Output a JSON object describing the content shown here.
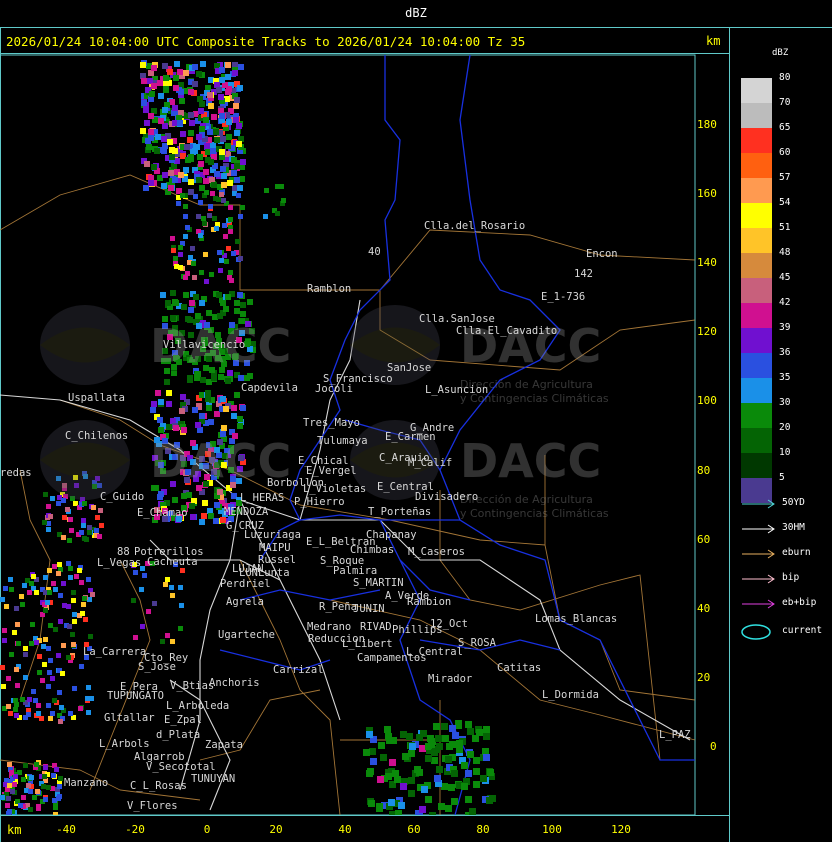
{
  "window": {
    "title": "dBZ"
  },
  "header": {
    "text": "2026/01/24 10:04:00 UTC Composite Tracks to 2026/01/24 10:04:00 Tz 35"
  },
  "axis": {
    "unit": "km",
    "x_ticks": [
      "-40",
      "-20",
      "0",
      "20",
      "40",
      "60",
      "80",
      "100",
      "120"
    ],
    "y_ticks": [
      "180",
      "160",
      "140",
      "120",
      "100",
      "80",
      "60",
      "40",
      "20",
      "0"
    ]
  },
  "legend": {
    "title": "dBZ",
    "levels": [
      {
        "label": "80",
        "color": "#d4d4d4"
      },
      {
        "label": "70",
        "color": "#bcbcbc"
      },
      {
        "label": "65",
        "color": "#ff3020"
      },
      {
        "label": "60",
        "color": "#ff6010"
      },
      {
        "label": "57",
        "color": "#ff9a50"
      },
      {
        "label": "54",
        "color": "#ffff00"
      },
      {
        "label": "51",
        "color": "#ffc428"
      },
      {
        "label": "48",
        "color": "#d68a3c"
      },
      {
        "label": "45",
        "color": "#c8607c"
      },
      {
        "label": "42",
        "color": "#d01090"
      },
      {
        "label": "39",
        "color": "#7010d0"
      },
      {
        "label": "36",
        "color": "#2a50e0"
      },
      {
        "label": "35",
        "color": "#1a90e8"
      },
      {
        "label": "30",
        "color": "#0a8a0a"
      },
      {
        "label": "20",
        "color": "#046404"
      },
      {
        "label": "10",
        "color": "#003800"
      },
      {
        "label": "5",
        "color": "#4a3a90"
      }
    ],
    "tracks": [
      {
        "label": "50YD",
        "color": "#50d8d8"
      },
      {
        "label": "30HM",
        "color": "#ffffff"
      },
      {
        "label": "eburn",
        "color": "#e8b060"
      },
      {
        "label": "bip",
        "color": "#ffc0d0"
      },
      {
        "label": "eb+bip",
        "color": "#e040e0"
      }
    ],
    "current": {
      "label": "current",
      "color": "#30e0e0"
    }
  },
  "watermark": {
    "brand": "DACC",
    "line1": "Dirección de Agricultura",
    "line2": "y Contingencias Climáticas"
  },
  "places": [
    "Clla.del_Rosario",
    "Encon",
    "142",
    "E_1-736",
    "Ramblon",
    "40",
    "Clla.SanJose",
    "Clla.El_Cavadito",
    "Villavicencio",
    "Capdevila",
    "S_Francisco",
    "SanJose",
    "Jocoli",
    "L_Asuncion",
    "Uspallata",
    "Tres_Mayo",
    "G_Andre",
    "C_Chilenos",
    "Tulumaya",
    "E_Carmen",
    "redas",
    "E_Chical",
    "C_Arauio",
    "M_Calif",
    "E_Vergel",
    "Borbollon",
    "L_Violetas",
    "E_Central",
    "Divisadero",
    "C_Guido",
    "L_HERAS",
    "P_Hierro",
    "E_Chamao",
    "MENDOZA",
    "T_Porteñas",
    "G_CRUZ",
    "Luzuriaga",
    "Chapanay",
    "E_L_Beltran",
    "MAIPU",
    "Chimbas",
    "M_Caseros",
    "88",
    "Potrerillos",
    "Russel",
    "L_Vegas",
    "Cacheuta",
    "S_Roque",
    "LUJAN",
    "Palmira",
    "LUNLunta",
    "Perdriel",
    "S_MARTIN",
    "A_Verde",
    "R_Peña",
    "JUNIN",
    "Rambion",
    "Agrela",
    "Lomas_Blancas",
    "Medrano",
    "RIVAD",
    "Phillips",
    "12_Oct",
    "Ugarteche",
    "Reduccion",
    "L_Libert",
    "S_ROSA",
    "La_Carrera",
    "Cto_Rey",
    "Campamentos",
    "L_Central",
    "S_Jose",
    "Carrizal",
    "Catitas",
    "E_Pera",
    "V_Btias",
    "Anchoris",
    "TUPUNGATO",
    "Mirador",
    "L_Dormida",
    "L_Arboleda",
    "Gltallar",
    "E_Zpal",
    "d_Plata",
    "L_PAZ",
    "L_Arbols",
    "Zapata",
    "Algarrob",
    "V_Secototal",
    "TUNUYAN",
    "Manzano",
    "C_L_Rosas",
    "V_Flores"
  ]
}
